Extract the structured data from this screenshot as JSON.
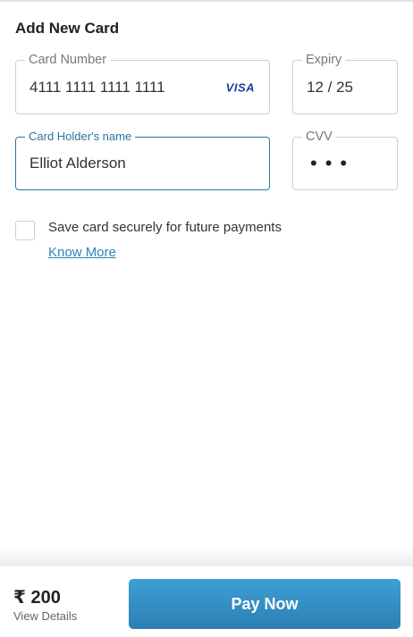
{
  "page": {
    "title": "Add New Card"
  },
  "card_form": {
    "card_number": {
      "label": "Card Number",
      "value": "4111 1111 1111 1111",
      "brand": "VISA"
    },
    "expiry": {
      "label": "Expiry",
      "value": "12 / 25"
    },
    "holder": {
      "label": "Card Holder's name",
      "value": "Elliot Alderson"
    },
    "cvv": {
      "label": "CVV",
      "value": "•••"
    }
  },
  "save_card": {
    "checked": false,
    "label": "Save card securely for future payments",
    "link": "Know More"
  },
  "footer": {
    "amount": "₹ 200",
    "details_link": "View Details",
    "pay_label": "Pay Now"
  },
  "colors": {
    "accent": "#2a74a0",
    "link": "#2a86b8",
    "button": "#3497cc",
    "visa": "#1a3f9c"
  }
}
